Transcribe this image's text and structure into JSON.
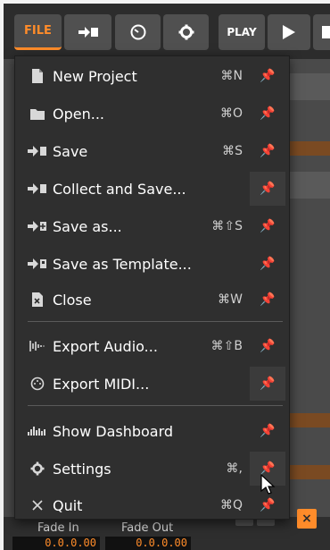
{
  "toolbar": {
    "file_label": "FILE",
    "play_label": "PLAY",
    "save_icon": "save-icon",
    "meter_icon": "meter-icon",
    "settings_icon": "gear-icon",
    "play_icon": "play-icon",
    "stop_icon": "stop-icon"
  },
  "menu": {
    "items": [
      {
        "label": "New Project",
        "shortcut": "⌘N",
        "icon": "new-file-icon",
        "pinned": false
      },
      {
        "label": "Open...",
        "shortcut": "⌘O",
        "icon": "folder-icon",
        "pinned": false
      },
      {
        "label": "Save",
        "shortcut": "⌘S",
        "icon": "save-icon",
        "pinned": false
      },
      {
        "label": "Collect and Save...",
        "shortcut": "",
        "icon": "collect-save-icon",
        "pinned": true
      },
      {
        "label": "Save as...",
        "shortcut": "⌘⇧S",
        "icon": "save-as-icon",
        "pinned": false
      },
      {
        "label": "Save as Template...",
        "shortcut": "",
        "icon": "save-template-icon",
        "pinned": false
      },
      {
        "label": "Close",
        "shortcut": "⌘W",
        "icon": "close-file-icon",
        "pinned": false
      },
      {
        "label": "Export Audio...",
        "shortcut": "⌘⇧B",
        "icon": "waveform-icon",
        "pinned": false
      },
      {
        "label": "Export MIDI...",
        "shortcut": "",
        "icon": "midi-icon",
        "pinned": true
      },
      {
        "label": "Show Dashboard",
        "shortcut": "",
        "icon": "dashboard-icon",
        "pinned": false
      },
      {
        "label": "Settings",
        "shortcut": "⌘,",
        "icon": "gear-icon",
        "pinned": true
      },
      {
        "label": "Quit",
        "shortcut": "⌘Q",
        "icon": "x-icon",
        "pinned": false
      }
    ]
  },
  "bottom": {
    "fade_in_label": "Fade In",
    "fade_out_label": "Fade Out",
    "fade_in_value": "0.0.0.00",
    "fade_out_value": "0.0.0.00",
    "x_label": "×"
  },
  "colors": {
    "accent": "#ff8c2a",
    "menu_bg": "#2f2f2f",
    "toolbar_bg": "#2c2c2c"
  }
}
